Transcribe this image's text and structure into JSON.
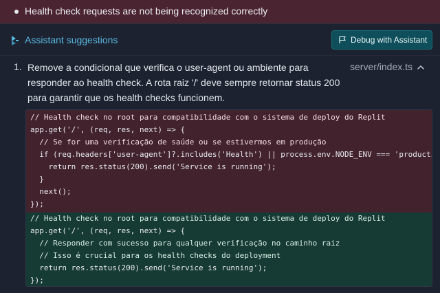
{
  "banner": {
    "text": "Health check requests are not being recognized correctly"
  },
  "header": {
    "title": "Assistant suggestions",
    "icon": "assistant-icon",
    "debug_button_label": "Debug with Assistant",
    "debug_button_icon": "flag-icon"
  },
  "suggestion": {
    "number": "1.",
    "lines": [
      "Remove a condicional que verifica o user-agent ou ambiente para",
      "responder ao health check. A rota raiz '/' deve sempre retornar status 200",
      "para garantir que os health checks funcionem."
    ],
    "file": "server/index.ts",
    "collapse_icon": "chevron-up-icon"
  },
  "diff": {
    "removed": [
      "// Health check no root para compatibilidade com o sistema de deploy do Replit",
      "app.get('/', (req, res, next) => {",
      "  // Se for uma verificação de saúde ou se estivermos em produção",
      "  if (req.headers['user-agent']?.includes('Health') || process.env.NODE_ENV === 'producti",
      "    return res.status(200).send('Service is running');",
      "  }",
      "  next();",
      "});"
    ],
    "added": [
      "// Health check no root para compatibilidade com o sistema de deploy do Replit",
      "app.get('/', (req, res, next) => {",
      "  // Responder com sucesso para qualquer verificação no caminho raiz",
      "  // Isso é crucial para os health checks do deployment",
      "  return res.status(200).send('Service is running');",
      "});"
    ]
  },
  "colors": {
    "accent": "#59b8e0",
    "removed_bg": "#42222d",
    "added_bg": "#163a34",
    "banner_bg": "#4a2430"
  }
}
